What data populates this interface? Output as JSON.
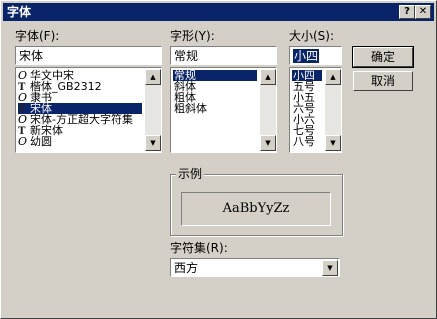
{
  "window": {
    "title": "字体",
    "help_glyph": "?",
    "close_glyph": "✕"
  },
  "font": {
    "label": "字体(F):",
    "value": "宋体",
    "items": [
      {
        "name": "华文中宋",
        "icon": "opentype-icon"
      },
      {
        "name": "楷体_GB2312",
        "icon": "truetype-icon"
      },
      {
        "name": "隶书",
        "icon": "opentype-icon"
      },
      {
        "name": "宋体",
        "icon": "truetype-icon"
      },
      {
        "name": "宋体-方正超大字符集",
        "icon": "opentype-icon"
      },
      {
        "name": "新宋体",
        "icon": "truetype-icon"
      },
      {
        "name": "幼圆",
        "icon": "opentype-icon"
      }
    ],
    "selected_index": 3
  },
  "style": {
    "label": "字形(Y):",
    "value": "常规",
    "items": [
      "常规",
      "斜体",
      "粗体",
      "粗斜体"
    ],
    "selected_index": 0
  },
  "size": {
    "label": "大小(S):",
    "value": "小四",
    "items": [
      "小四",
      "五号",
      "小五",
      "六号",
      "小六",
      "七号",
      "八号"
    ],
    "selected_index": 0
  },
  "buttons": {
    "ok": "确定",
    "cancel": "取消"
  },
  "sample": {
    "group_label": "示例",
    "text": "AaBbYyZz"
  },
  "charset": {
    "label": "字符集(R):",
    "value": "西方"
  },
  "scroll": {
    "up_glyph": "▲",
    "down_glyph": "▼"
  }
}
